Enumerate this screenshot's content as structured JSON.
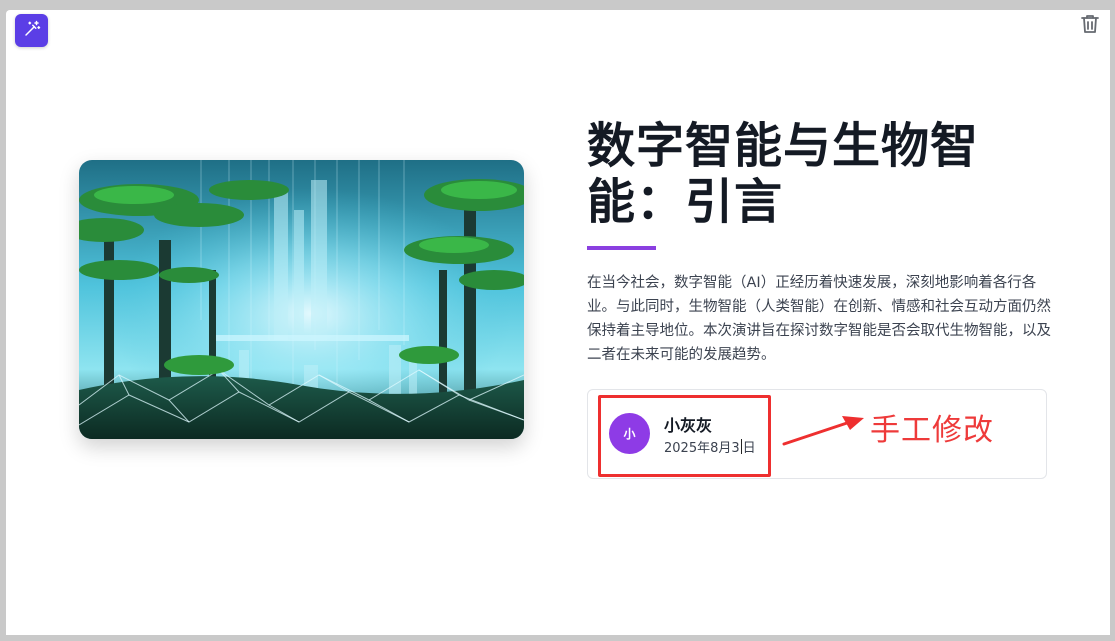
{
  "toolbar": {
    "magic_icon": "magic-wand-icon",
    "delete_icon": "trash-icon"
  },
  "slide": {
    "image_alt": "futuristic forest city illustration",
    "title": "数字智能与生物智能：引言",
    "intro": "在当今社会，数字智能（AI）正经历着快速发展，深刻地影响着各行各业。与此同时，生物智能（人类智能）在创新、情感和社会互动方面仍然保持着主导地位。本次演讲旨在探讨数字智能是否会取代生物智能，以及二者在未来可能的发展趋势。",
    "author": {
      "avatar_initial": "小",
      "name": "小灰灰",
      "date_before_caret": "2025年8月3",
      "date_after_caret": "日"
    }
  },
  "annotation": {
    "text": "手工修改"
  },
  "colors": {
    "accent_purple": "#8a3fe0",
    "magic_button": "#5b3ee6",
    "annotation_red": "#ee2f2f",
    "title": "#141a24"
  }
}
